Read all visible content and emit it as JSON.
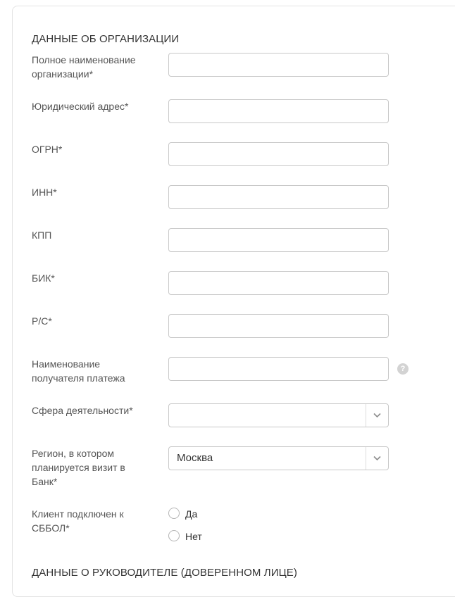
{
  "section_org": {
    "title": "ДАННЫЕ ОБ ОРГАНИЗАЦИИ"
  },
  "fields": {
    "full_name": {
      "label": "Полное наименование организации*",
      "value": ""
    },
    "legal_address": {
      "label": "Юридический адрес*",
      "value": ""
    },
    "ogrn": {
      "label": "ОГРН*",
      "value": ""
    },
    "inn": {
      "label": "ИНН*",
      "value": ""
    },
    "kpp": {
      "label": "КПП",
      "value": ""
    },
    "bik": {
      "label": "БИК*",
      "value": ""
    },
    "account": {
      "label": "Р/С*",
      "value": ""
    },
    "payee_name": {
      "label": "Наименование получателя платежа",
      "value": "",
      "help_icon": "?"
    },
    "activity": {
      "label": "Сфера деятельности*",
      "selected": ""
    },
    "region": {
      "label": "Регион, в котором планируется визит в Банк*",
      "selected": "Москва"
    },
    "sbbol": {
      "label": "Клиент подключен к СББОЛ*",
      "options": [
        "Да",
        "Нет"
      ],
      "selected": null
    }
  },
  "section_manager": {
    "title": "ДАННЫЕ О РУКОВОДИТЕЛЕ (ДОВЕРЕННОМ ЛИЦЕ)"
  },
  "icons": {
    "dropdown": "chevron-down-icon",
    "help": "help-icon"
  },
  "colors": {
    "border": "#c8c8c8",
    "text": "#333333",
    "label": "#555555",
    "help_bg": "#d3d3d3"
  }
}
